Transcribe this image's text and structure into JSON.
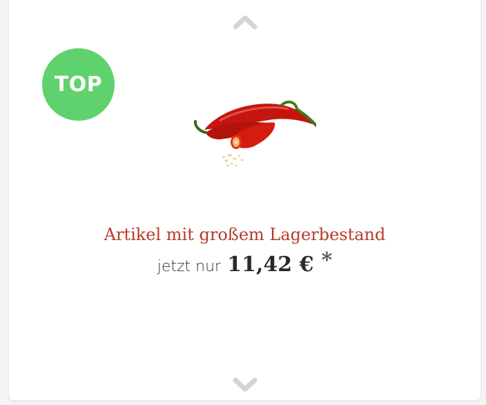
{
  "slider": {
    "prev_icon": "chevron-up-icon",
    "next_icon": "chevron-down-icon",
    "arrow_color": "#d4d4d4"
  },
  "product": {
    "badge": "TOP",
    "badge_color": "#5fd26e",
    "image_icon": "chili-pepper-image",
    "title": "Artikel mit großem Lagerbestand",
    "title_color": "#b53a2a",
    "price_prefix": "jetzt nur",
    "price": "11,42 €",
    "price_note": "*"
  }
}
